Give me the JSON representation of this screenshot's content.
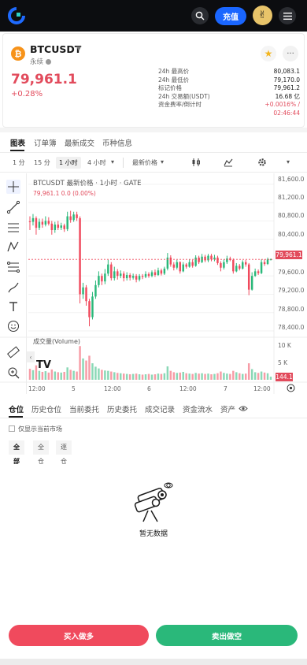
{
  "topnav": {
    "deposit_label": "充值",
    "icons": [
      "logo-icon",
      "search-icon",
      "avatar-icon",
      "menu-icon"
    ]
  },
  "header": {
    "symbol": "BTCUSDT",
    "contract_type": "永续",
    "last_price": "79,961.1",
    "change_pct": "+0.28%",
    "stats": [
      {
        "label": "24h 最高价",
        "value": "80,083.1"
      },
      {
        "label": "24h 最低价",
        "value": "79,170.0"
      },
      {
        "label": "标记价格",
        "value": "79,961.2"
      },
      {
        "label": "24h 交易额(USDT)",
        "value": "16.68 亿"
      },
      {
        "label": "资金费率/倒计时",
        "value": "+0.0016% /"
      }
    ],
    "countdown": "02:46:44"
  },
  "main_tabs": [
    {
      "label": "图表",
      "active": true
    },
    {
      "label": "订单簿",
      "active": false
    },
    {
      "label": "最新成交",
      "active": false
    },
    {
      "label": "币种信息",
      "active": false
    }
  ],
  "timeframes": {
    "items": [
      "1 分",
      "15 分",
      "1 小时",
      "4 小时"
    ],
    "active": "1 小时",
    "price_type": "最新价格"
  },
  "chart": {
    "title": "BTCUSDT 最新价格 · 1小时 · GATE",
    "ohlc_readout": "79,961.1  0.0 (0.00%)",
    "volume_label": "成交量(Volume)",
    "price_tag": "79,961.1",
    "volume_tag": "144.1",
    "price_axis": [
      "81,600.0",
      "81,200.0",
      "80,800.0",
      "80,400.0",
      "79,600.0",
      "79,200.0",
      "78,800.0",
      "78,400.0"
    ],
    "volume_axis": [
      "10 K",
      "5 K"
    ],
    "time_axis": [
      "12:00",
      "5",
      "12:00",
      "6",
      "12:00",
      "7",
      "12:00"
    ],
    "tv_logo": "TV"
  },
  "chart_data": {
    "type": "candlestick",
    "title": "BTCUSDT 最新价格 · 1小时 · GATE",
    "ylim": [
      78400,
      81700
    ],
    "candles": [
      [
        80790,
        80780,
        80900,
        80600
      ],
      [
        80780,
        80860,
        80950,
        80700
      ],
      [
        80860,
        80650,
        80900,
        80500
      ],
      [
        80650,
        80780,
        80850,
        80600
      ],
      [
        80780,
        80720,
        80850,
        80650
      ],
      [
        80720,
        80800,
        80900,
        80680
      ],
      [
        80800,
        80740,
        80880,
        80700
      ],
      [
        80740,
        80600,
        80800,
        80500
      ],
      [
        80600,
        80720,
        80780,
        80540
      ],
      [
        80720,
        80650,
        80800,
        80600
      ],
      [
        80650,
        80700,
        80760,
        80600
      ],
      [
        80700,
        80620,
        80740,
        80560
      ],
      [
        80620,
        80900,
        81000,
        80580
      ],
      [
        80900,
        80820,
        81020,
        80760
      ],
      [
        80820,
        80940,
        81000,
        80780
      ],
      [
        80940,
        80860,
        81000,
        80800
      ],
      [
        80860,
        79200,
        80900,
        79000
      ],
      [
        79200,
        79350,
        79450,
        79100
      ],
      [
        79350,
        79050,
        79400,
        78950
      ],
      [
        79050,
        78700,
        79100,
        78500
      ],
      [
        78700,
        79150,
        79250,
        78650
      ],
      [
        79150,
        79400,
        79500,
        79100
      ],
      [
        79400,
        79600,
        79700,
        79350
      ],
      [
        79600,
        79480,
        79650,
        79400
      ],
      [
        79480,
        79650,
        79750,
        79420
      ],
      [
        79650,
        79850,
        79950,
        79600
      ],
      [
        79850,
        79550,
        79900,
        79500
      ],
      [
        79550,
        79700,
        79800,
        79500
      ],
      [
        79700,
        79600,
        79750,
        79520
      ],
      [
        79600,
        79650,
        79720,
        79550
      ],
      [
        79650,
        79550,
        79700,
        79480
      ],
      [
        79550,
        79620,
        79680,
        79500
      ],
      [
        79620,
        79560,
        79660,
        79500
      ],
      [
        79560,
        79600,
        79650,
        79520
      ],
      [
        79600,
        79520,
        79640,
        79460
      ],
      [
        79520,
        79600,
        79640,
        79480
      ],
      [
        79600,
        79580,
        79640,
        79530
      ],
      [
        79580,
        79640,
        79700,
        79550
      ],
      [
        79640,
        79600,
        79680,
        79560
      ],
      [
        79600,
        79680,
        79720,
        79570
      ],
      [
        79680,
        79620,
        79740,
        79580
      ],
      [
        79620,
        79720,
        79780,
        79600
      ],
      [
        79720,
        79650,
        79760,
        79610
      ],
      [
        79650,
        79760,
        79800,
        79620
      ],
      [
        79760,
        80000,
        80100,
        79720
      ],
      [
        80000,
        79850,
        80050,
        79800
      ],
      [
        79850,
        79780,
        79900,
        79720
      ],
      [
        79780,
        79900,
        79950,
        79740
      ],
      [
        79900,
        79700,
        79920,
        79650
      ],
      [
        79700,
        79850,
        79900,
        79680
      ],
      [
        79850,
        79800,
        79880,
        79760
      ],
      [
        79800,
        79900,
        79960,
        79780
      ],
      [
        79900,
        79820,
        79950,
        79780
      ],
      [
        79820,
        80000,
        80050,
        79800
      ],
      [
        80000,
        79900,
        80040,
        79860
      ],
      [
        79900,
        80020,
        80080,
        79880
      ],
      [
        80020,
        79940,
        80060,
        79900
      ],
      [
        79940,
        80040,
        80080,
        79900
      ],
      [
        80040,
        79960,
        80080,
        79920
      ],
      [
        79960,
        80000,
        80060,
        79920
      ],
      [
        80000,
        79880,
        80040,
        79840
      ],
      [
        79880,
        79780,
        79920,
        79700
      ],
      [
        79780,
        79900,
        79960,
        79740
      ],
      [
        79900,
        79980,
        80040,
        79860
      ],
      [
        79980,
        79950,
        80020,
        79920
      ],
      [
        79950,
        79700,
        79980,
        79650
      ],
      [
        79700,
        79820,
        79880,
        79680
      ],
      [
        79820,
        79760,
        79860,
        79720
      ],
      [
        79760,
        79900,
        79940,
        79740
      ],
      [
        79900,
        79850,
        79950,
        79800
      ],
      [
        79850,
        79300,
        79880,
        79180
      ],
      [
        79300,
        79600,
        79680,
        79280
      ],
      [
        79600,
        79700,
        79760,
        79580
      ],
      [
        79700,
        79660,
        79740,
        79620
      ],
      [
        79660,
        79900,
        79960,
        79640
      ],
      [
        79900,
        79860,
        79960,
        79820
      ],
      [
        79860,
        79960,
        80000,
        79840
      ],
      [
        79960,
        79961,
        79980,
        79940
      ]
    ],
    "volumes": [
      3200,
      2800,
      4200,
      2600,
      2300,
      2500,
      2100,
      3000,
      2400,
      2200,
      2100,
      2300,
      3600,
      2900,
      2600,
      2400,
      9800,
      6200,
      5600,
      7000,
      4800,
      3800,
      3300,
      2900,
      2700,
      2600,
      2400,
      2200,
      2000,
      1900,
      1800,
      1700,
      1600,
      1700,
      1800,
      1600,
      1500,
      1600,
      1700,
      1500,
      1600,
      1800,
      1700,
      1900,
      3900,
      2600,
      2200,
      2000,
      2100,
      2300,
      1900,
      1800,
      1700,
      2000,
      1800,
      1900,
      1700,
      1800,
      1600,
      1700,
      1900,
      2400,
      2000,
      1800,
      1700,
      2600,
      2200,
      1900,
      1700,
      1800,
      4800,
      3100,
      2200,
      2000,
      2400,
      2100,
      1900,
      900
    ],
    "price_axis_ticks": [
      81600,
      81200,
      80800,
      80400,
      79600,
      79200,
      78800,
      78400
    ],
    "volume_axis_ticks": [
      "10 K",
      "5 K"
    ],
    "time_ticks": [
      "12:00",
      "5",
      "12:00",
      "6",
      "12:00",
      "7",
      "12:00"
    ],
    "last_price": 79961.1,
    "last_volume": 144.1,
    "up_color": "#2ab87a",
    "down_color": "#f04a5d"
  },
  "positions": {
    "tabs": [
      "仓位",
      "历史仓位",
      "当前委托",
      "历史委托",
      "成交记录",
      "资金流水",
      "资产"
    ],
    "current_market_only": "仅显示当前市场",
    "filters": [
      "全部",
      "全仓",
      "逐仓"
    ],
    "empty_text": "暂无数据"
  },
  "actions": {
    "buy_label": "买入做多",
    "sell_label": "卖出做空"
  },
  "colors": {
    "accent": "#1a66ff",
    "up": "#2ab87a",
    "down": "#f04a5d"
  }
}
